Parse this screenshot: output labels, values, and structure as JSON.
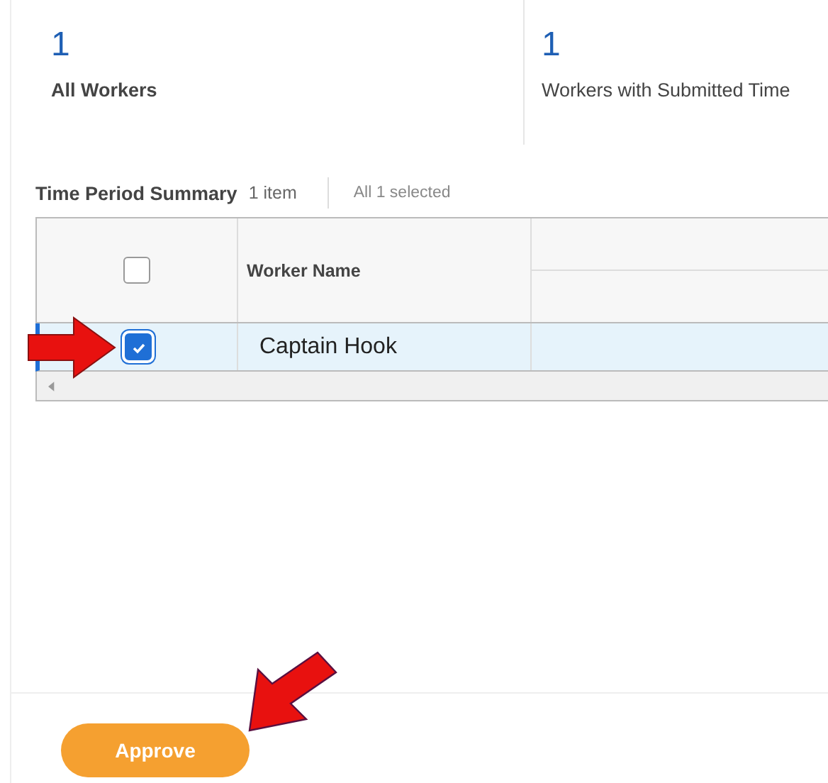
{
  "metrics": [
    {
      "value": "1",
      "label": "All Workers",
      "emphasis": true
    },
    {
      "value": "1",
      "label": "Workers with Submitted Time",
      "emphasis": false
    }
  ],
  "table": {
    "title": "Time Period Summary",
    "count": "1 item",
    "selection_note": "All 1 selected",
    "select_all_checked": false,
    "columns": [
      "Worker Name"
    ],
    "rows": [
      {
        "worker_name": "Captain Hook",
        "selected": true
      }
    ]
  },
  "button": "Approve"
}
